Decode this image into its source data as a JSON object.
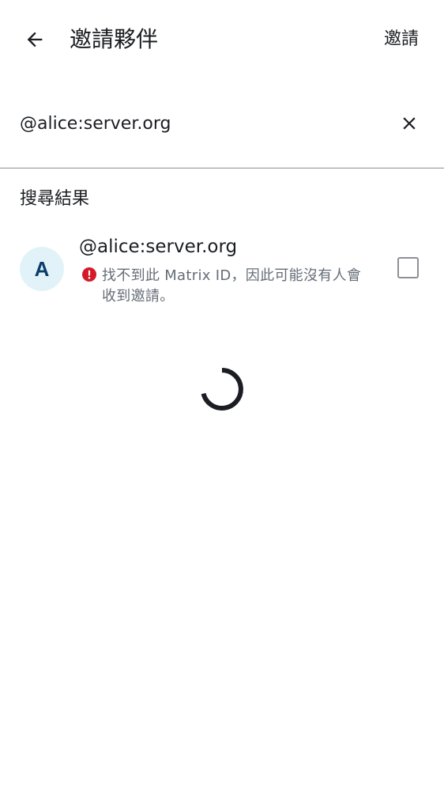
{
  "header": {
    "title": "邀請夥伴",
    "invite_label": "邀請",
    "back_icon": "arrow-left-icon"
  },
  "search": {
    "value": "@alice:server.org",
    "clear_icon": "close-icon"
  },
  "results": {
    "section_label": "搜尋結果",
    "items": [
      {
        "avatar_letter": "A",
        "name": "@alice:server.org",
        "warning": "找不到此 Matrix ID，因此可能沒有人會收到邀請。",
        "warning_icon": "error-icon",
        "checked": false
      }
    ]
  },
  "colors": {
    "avatar_bg": "#e1f3f9",
    "avatar_fg": "#0c3d68",
    "error": "#d51928",
    "text_primary": "#1b1d22",
    "text_secondary": "#656d77",
    "divider": "#8d9096"
  },
  "loading": true
}
